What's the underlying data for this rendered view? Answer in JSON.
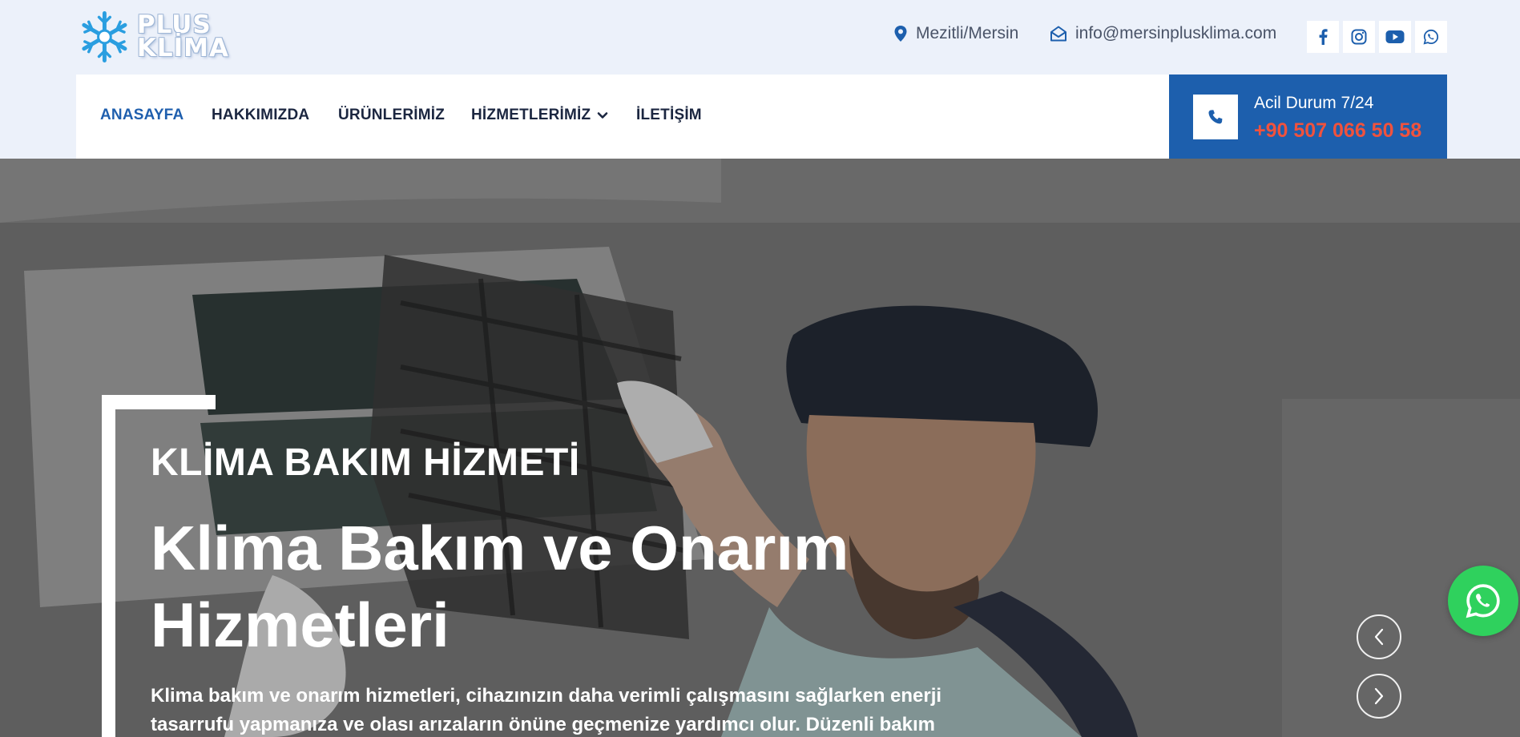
{
  "brand": {
    "logo_line1": "PLUS",
    "logo_line2": "KLİMA"
  },
  "topbar": {
    "location": "Mezitli/Mersin",
    "email": "info@mersinplusklima.com",
    "social_icons": [
      "facebook-icon",
      "instagram-icon",
      "youtube-icon",
      "whatsapp-icon"
    ]
  },
  "nav": {
    "items": [
      {
        "label": "ANASAYFA",
        "active": true
      },
      {
        "label": "HAKKIMIZDA"
      },
      {
        "label": "ÜRÜNLERİMİZ"
      },
      {
        "label": "HİZMETLERİMİZ",
        "has_dropdown": true
      },
      {
        "label": "İLETİŞİM"
      }
    ]
  },
  "emergency": {
    "label": "Acil Durum 7/24",
    "phone": "+90 507 066 50 58"
  },
  "hero": {
    "subtitle": "KLİMA BAKIM HİZMETİ",
    "title_line1": "Klima Bakım ve Onarım",
    "title_line2": "Hizmetleri",
    "description": "Klima bakım ve onarım hizmetleri, cihazınızın daha verimli çalışmasını sağlarken enerji tasarrufu yapmanıza ve olası arızaların önüne geçmenize yardımcı olur. Düzenli bakım"
  },
  "colors": {
    "brand_blue": "#1d5fad",
    "phone_accent": "#f0523d",
    "topbar_bg": "#ecf1fa",
    "whatsapp_green": "#2fd15d"
  }
}
